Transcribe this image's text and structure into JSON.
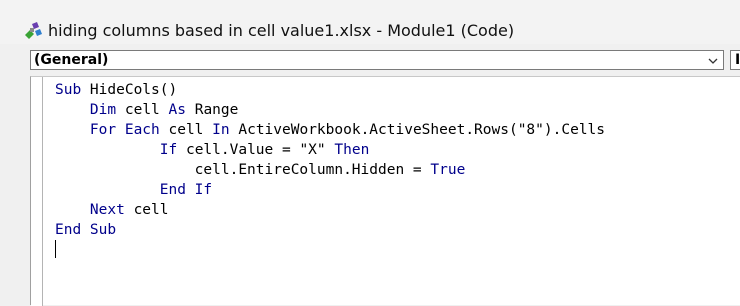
{
  "window": {
    "title": "hiding columns based in cell value1.xlsx - Module1 (Code)",
    "icon": "vba-module-icon"
  },
  "toolbar": {
    "object_combo_value": "(General)",
    "procedure_combo_value": "I"
  },
  "colors": {
    "keyword": "#00008b",
    "text": "#000000",
    "background": "#ffffff"
  },
  "code": {
    "lines": [
      [
        {
          "t": "Sub",
          "k": true
        },
        {
          "t": " HideCols()",
          "k": false
        }
      ],
      [
        {
          "t": "    ",
          "k": false
        },
        {
          "t": "Dim",
          "k": true
        },
        {
          "t": " cell ",
          "k": false
        },
        {
          "t": "As",
          "k": true
        },
        {
          "t": " Range",
          "k": false
        }
      ],
      [
        {
          "t": "    ",
          "k": false
        },
        {
          "t": "For Each",
          "k": true
        },
        {
          "t": " cell ",
          "k": false
        },
        {
          "t": "In",
          "k": true
        },
        {
          "t": " ActiveWorkbook.ActiveSheet.Rows(\"8\").Cells",
          "k": false
        }
      ],
      [
        {
          "t": "            ",
          "k": false
        },
        {
          "t": "If",
          "k": true
        },
        {
          "t": " cell.Value = \"X\" ",
          "k": false
        },
        {
          "t": "Then",
          "k": true
        }
      ],
      [
        {
          "t": "                cell.EntireColumn.Hidden = ",
          "k": false
        },
        {
          "t": "True",
          "k": true
        }
      ],
      [
        {
          "t": "            ",
          "k": false
        },
        {
          "t": "End If",
          "k": true
        }
      ],
      [
        {
          "t": "    ",
          "k": false
        },
        {
          "t": "Next",
          "k": true
        },
        {
          "t": " cell",
          "k": false
        }
      ],
      [
        {
          "t": "End Sub",
          "k": true
        }
      ]
    ]
  }
}
